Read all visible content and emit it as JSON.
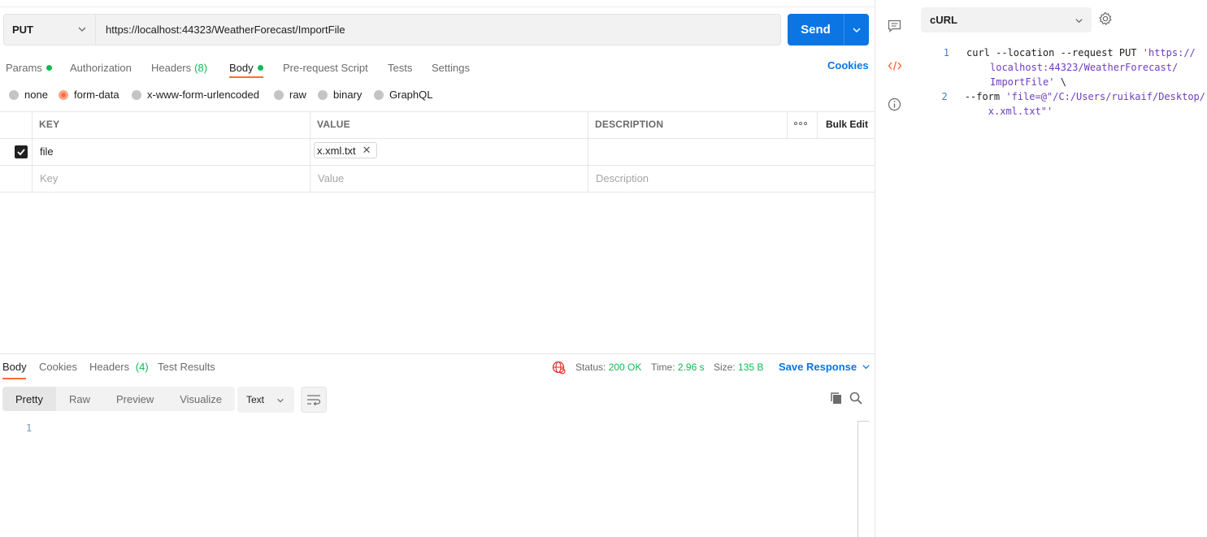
{
  "request": {
    "method": "PUT",
    "url": "https://localhost:44323/WeatherForecast/ImportFile",
    "send_label": "Send"
  },
  "request_tabs": {
    "params": "Params",
    "authorization": "Authorization",
    "headers": "Headers",
    "headers_count": "(8)",
    "body": "Body",
    "pre_request": "Pre-request Script",
    "tests": "Tests",
    "settings": "Settings",
    "cookies": "Cookies"
  },
  "body_types": {
    "none": "none",
    "form_data": "form-data",
    "urlencoded": "x-www-form-urlencoded",
    "raw": "raw",
    "binary": "binary",
    "graphql": "GraphQL",
    "selected": "form-data"
  },
  "params_table": {
    "headers": {
      "key": "KEY",
      "value": "VALUE",
      "description": "DESCRIPTION",
      "bulk_edit": "Bulk Edit"
    },
    "row": {
      "key": "file",
      "value": "x.xml.txt",
      "checked": true
    },
    "placeholders": {
      "key": "Key",
      "value": "Value",
      "description": "Description"
    }
  },
  "response": {
    "tabs": {
      "body": "Body",
      "cookies": "Cookies",
      "headers": "Headers",
      "headers_count": "(4)",
      "test_results": "Test Results"
    },
    "status_label": "Status:",
    "status_value": "200 OK",
    "time_label": "Time:",
    "time_value": "2.96 s",
    "size_label": "Size:",
    "size_value": "135 B",
    "save_response": "Save Response",
    "views": {
      "pretty": "Pretty",
      "raw": "Raw",
      "preview": "Preview",
      "visualize": "Visualize"
    },
    "format": "Text",
    "line_number": "1"
  },
  "code_panel": {
    "language": "cURL",
    "lines": [
      {
        "no": "1",
        "prefix": "curl --location --request PUT ",
        "string": "'https://",
        "cont": [
          "localhost:44323/WeatherForecast/",
          "ImportFile'"
        ],
        "suffix": " \\"
      },
      {
        "no": "2",
        "prefix": "--form ",
        "string": "'file=@\"/C:/Users/ruikaif/Desktop/",
        "cont": [
          "x.xml.txt\"'"
        ],
        "suffix": ""
      }
    ]
  },
  "colors": {
    "accent": "#ff6c37",
    "primary": "#0b75e3",
    "success": "#0cbb52"
  }
}
